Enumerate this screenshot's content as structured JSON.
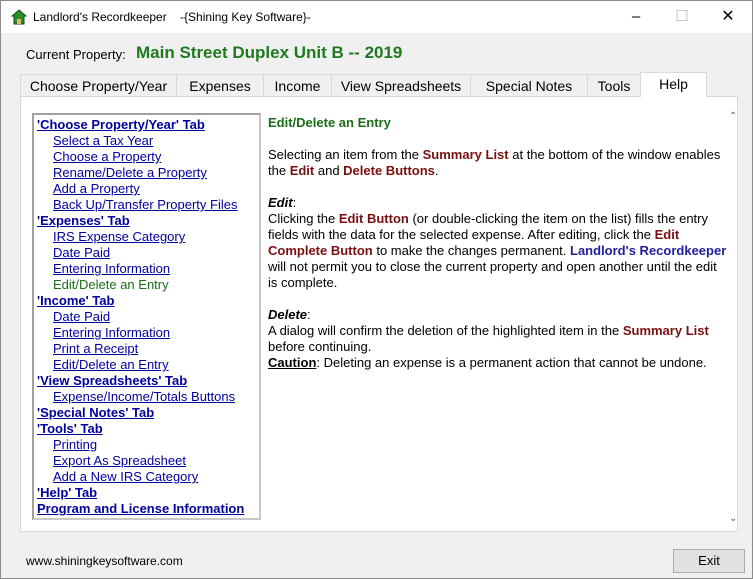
{
  "window": {
    "title": "Landlord's Recordkeeper    -{Shining Key Software}-",
    "minimize_glyph": "–",
    "maximize_glyph": "☐",
    "close_glyph": "✕"
  },
  "current_property": {
    "label": "Current Property:",
    "value": "Main Street Duplex Unit B -- 2019"
  },
  "tabs": [
    {
      "label": "Choose Property/Year"
    },
    {
      "label": "Expenses"
    },
    {
      "label": "Income"
    },
    {
      "label": "View Spreadsheets"
    },
    {
      "label": "Special Notes"
    },
    {
      "label": "Tools"
    },
    {
      "label": "Help",
      "active": true
    }
  ],
  "toc": [
    {
      "label": "'Choose Property/Year' Tab"
    },
    {
      "label": "Select a Tax Year"
    },
    {
      "label": "Choose a Property"
    },
    {
      "label": "Rename/Delete a Property"
    },
    {
      "label": "Add a Property"
    },
    {
      "label": "Back Up/Transfer Property Files"
    },
    {
      "label": "'Expenses' Tab"
    },
    {
      "label": "IRS Expense Category"
    },
    {
      "label": "Date Paid"
    },
    {
      "label": "Entering Information"
    },
    {
      "label": "Edit/Delete an Entry"
    },
    {
      "label": "'Income' Tab"
    },
    {
      "label": "Date Paid"
    },
    {
      "label": "Entering Information"
    },
    {
      "label": "Print a Receipt"
    },
    {
      "label": "Edit/Delete an Entry"
    },
    {
      "label": "'View Spreadsheets' Tab"
    },
    {
      "label": "Expense/Income/Totals Buttons"
    },
    {
      "label": "'Special Notes' Tab"
    },
    {
      "label": "'Tools' Tab"
    },
    {
      "label": "Printing"
    },
    {
      "label": "Export As Spreadsheet"
    },
    {
      "label": "Add a New IRS Category"
    },
    {
      "label": "'Help' Tab"
    },
    {
      "label": "Program and License Information"
    }
  ],
  "content": {
    "title": "Edit/Delete an Entry",
    "p1": {
      "t1": "Selecting an item from the ",
      "k1": "Summary List",
      "t2": " at the bottom of the window enables the ",
      "k2": "Edit",
      "t3": " and ",
      "k3": "Delete Buttons",
      "t4": "."
    },
    "edit": {
      "heading": "Edit",
      "colon": ":",
      "t1": "Clicking the ",
      "k1": "Edit Button",
      "t2": " (or double-clicking the item on the list) fills the entry fields with the data for the selected expense. After editing, click the ",
      "k2": "Edit Complete Button",
      "t3": " to make the changes permanent. ",
      "k3": "Landlord's Recordkeeper",
      "t4": " will not permit you to close the current property and open another until the edit is complete."
    },
    "delete": {
      "heading": "Delete",
      "colon": ":",
      "t1": "A dialog will confirm the deletion of the highlighted item in the ",
      "k1": "Summary List",
      "t2": " before continuing.",
      "caution": "Caution",
      "t3": ": Deleting an expense is a permanent action that cannot be undone."
    }
  },
  "footer": {
    "url": "www.shiningkeysoftware.com",
    "exit_label": "Exit"
  },
  "icons": {
    "app": "house-icon",
    "scroll_up": "chevron-up-icon",
    "scroll_down": "chevron-down-icon"
  },
  "colors": {
    "property_green": "#1f7a1f",
    "link_blue": "#00009c",
    "current_topic_green": "#1a6e1a",
    "keyword_maroon": "#7a0f0f"
  }
}
